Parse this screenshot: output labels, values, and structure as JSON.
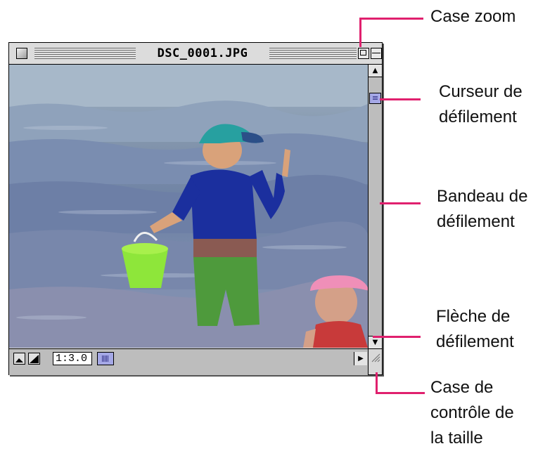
{
  "window": {
    "title": "DSC_0001.JPG",
    "zoom_level": "1:3.0"
  },
  "callouts": {
    "zoom_box": "Case zoom",
    "scroll_thumb": [
      "Curseur de",
      "défilement"
    ],
    "scroll_track": [
      "Bandeau de",
      "défilement"
    ],
    "scroll_arrow": [
      "Flèche de",
      "défilement"
    ],
    "size_box": [
      "Case de",
      "contrôle de",
      "la taille"
    ]
  },
  "colors": {
    "callout_line": "#e0206e",
    "scroll_thumb": "#a5a8e6"
  },
  "icons": {
    "close_box": "close-box-icon",
    "zoom_box": "zoom-box-icon",
    "collapse_box": "collapse-box-icon",
    "scroll_up": "arrow-up-icon",
    "scroll_down": "arrow-down-icon",
    "scroll_right": "arrow-right-icon",
    "size_box": "resize-grip-icon"
  }
}
